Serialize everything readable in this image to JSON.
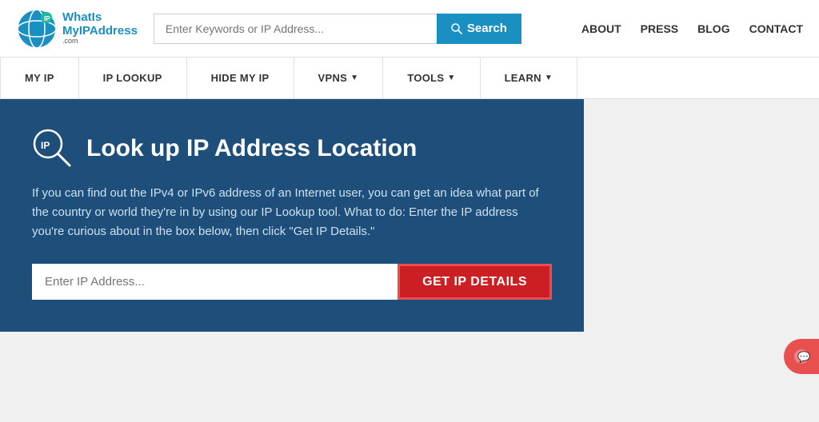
{
  "header": {
    "logo": {
      "what_is": "WhatIs",
      "my_ip": "MyIPAddress",
      "dot_com": ".com"
    },
    "search": {
      "placeholder": "Enter Keywords or IP Address...",
      "button_label": "Search"
    },
    "nav_links": [
      {
        "label": "ABOUT"
      },
      {
        "label": "PRESS"
      },
      {
        "label": "BLOG"
      },
      {
        "label": "CONTACT"
      }
    ]
  },
  "navbar": {
    "items": [
      {
        "label": "MY IP",
        "has_arrow": false
      },
      {
        "label": "IP LOOKUP",
        "has_arrow": false
      },
      {
        "label": "HIDE MY IP",
        "has_arrow": false
      },
      {
        "label": "VPNS",
        "has_arrow": true
      },
      {
        "label": "TOOLS",
        "has_arrow": true
      },
      {
        "label": "LEARN",
        "has_arrow": true
      }
    ]
  },
  "main": {
    "panel": {
      "title": "Look up IP Address Location",
      "description": "If you can find out the IPv4 or IPv6 address of an Internet user, you can get an idea what part of the country or world they're in by using our IP Lookup tool. What to do: Enter the IP address you're curious about in the box below, then click \"Get IP Details.\"",
      "ip_input_placeholder": "Enter IP Address...",
      "cta_button_label": "GET IP DETAILS"
    }
  },
  "colors": {
    "header_bg": "#ffffff",
    "search_btn": "#1a8fc1",
    "nav_bg": "#ffffff",
    "panel_bg": "#1e4f7a",
    "cta_bg": "#cc1f24",
    "body_bg": "#f0f0f0"
  }
}
